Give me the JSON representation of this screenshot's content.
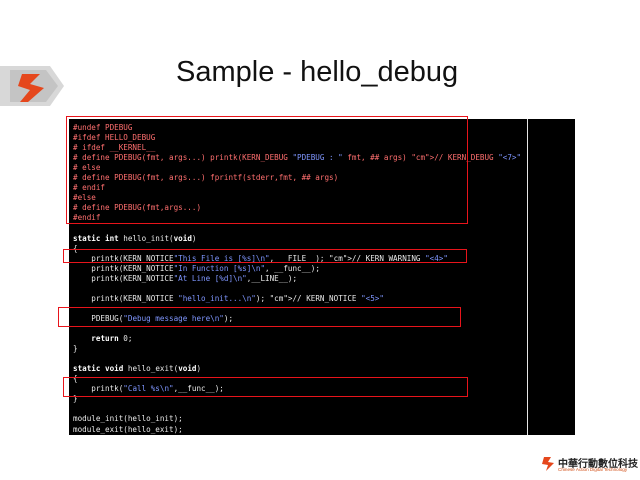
{
  "slide": {
    "title": "Sample - hello_debug"
  },
  "code_lines": [
    "#undef PDEBUG",
    "#ifdef HELLO_DEBUG",
    "# ifdef __KERNEL__",
    "# define PDEBUG(fmt, args...) printk(KERN_DEBUG \"PDEBUG : \" fmt, ## args) // KERN_DEBUG \"<7>\"",
    "# else",
    "# define PDEBUG(fmt, args...) fprintf(stderr,fmt, ## args)",
    "# endif",
    "#else",
    "# define PDEBUG(fmt,args...)",
    "#endif",
    "",
    "static int hello_init(void)",
    "{",
    "    printk(KERN_NOTICE\"This File is [%s]\\n\", __FILE__); // KERN_WARNING \"<4>\"",
    "    printk(KERN_NOTICE\"In Function [%s]\\n\", __func__);",
    "    printk(KERN_NOTICE\"At Line [%d]\\n\",__LINE__);",
    "",
    "    printk(KERN_NOTICE \"hello_init...\\n\"); // KERN_NOTICE \"<5>\"",
    "",
    "    PDEBUG(\"Debug message here\\n\");",
    "",
    "    return 0;",
    "}",
    "",
    "static void hello_exit(void)",
    "{",
    "    printk(\"Call %s\\n\",__func__);",
    "}",
    "",
    "module_init(hello_init);",
    "module_exit(hello_exit);"
  ],
  "brand": {
    "name": "中華行動數位科技",
    "sub": "Chinese Action Digital Technology"
  },
  "colors": {
    "highlight_box": "#e8141b",
    "logo_orange": "#e5471c",
    "editor_bg": "#000000"
  }
}
